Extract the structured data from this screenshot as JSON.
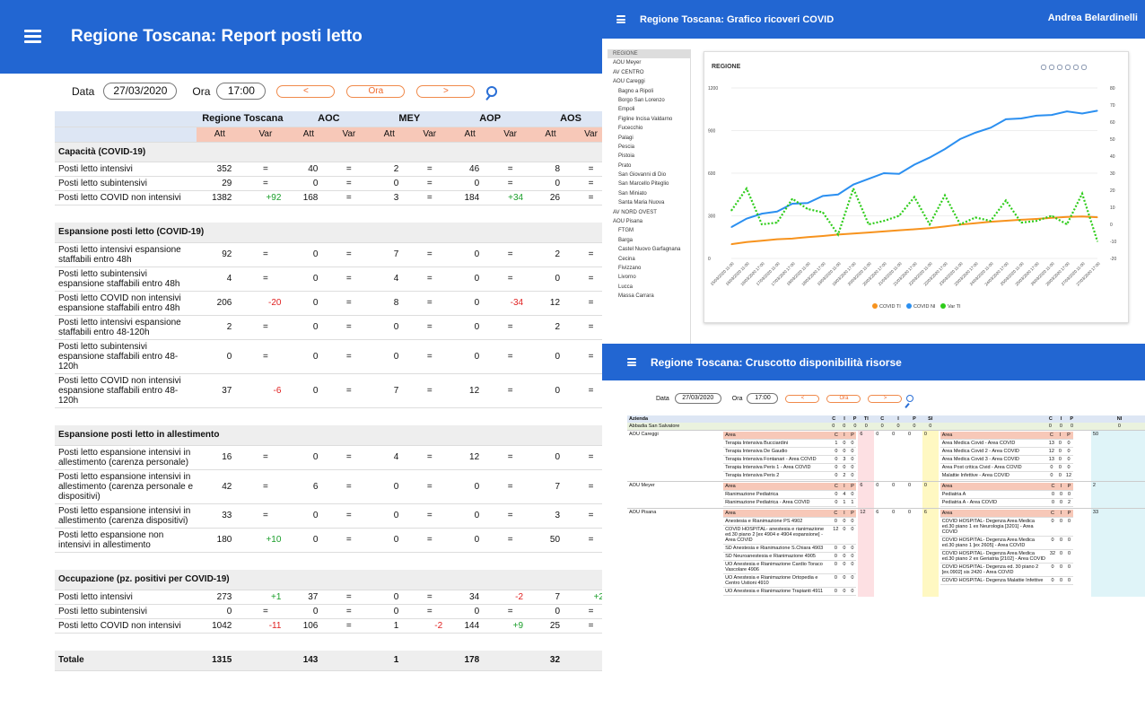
{
  "report": {
    "title": "Regione Toscana: Report posti letto",
    "data_label": "Data",
    "data_value": "27/03/2020",
    "ora_label": "Ora",
    "ora_value": "17:00",
    "btn_prev": "<",
    "btn_now": "Ora",
    "btn_next": ">",
    "columns": [
      "Regione Toscana",
      "AOC",
      "MEY",
      "AOP",
      "AOS"
    ],
    "att": "Att",
    "var": "Var",
    "sections": [
      {
        "title": "Capacità (COVID-19)",
        "rows": [
          {
            "label": "Posti letto intensivi",
            "vals": [
              "352",
              "=",
              "40",
              "=",
              "2",
              "=",
              "46",
              "=",
              "8",
              "="
            ]
          },
          {
            "label": "Posti letto subintensivi",
            "vals": [
              "29",
              "=",
              "0",
              "=",
              "0",
              "=",
              "0",
              "=",
              "0",
              "="
            ]
          },
          {
            "label": "Posti letto COVID non intensivi",
            "vals": [
              "1382",
              "+92",
              "168",
              "=",
              "3",
              "=",
              "184",
              "+34",
              "26",
              "="
            ]
          }
        ]
      },
      {
        "title": "Espansione posti letto (COVID-19)",
        "rows": [
          {
            "label": "Posti letto intensivi espansione staffabili entro 48h",
            "vals": [
              "92",
              "=",
              "0",
              "=",
              "7",
              "=",
              "0",
              "=",
              "2",
              "="
            ]
          },
          {
            "label": "Posti letto subintensivi espansione staffabili entro 48h",
            "vals": [
              "4",
              "=",
              "0",
              "=",
              "4",
              "=",
              "0",
              "=",
              "0",
              "="
            ]
          },
          {
            "label": "Posti letto COVID non intensivi espansione staffabili entro 48h",
            "vals": [
              "206",
              "-20",
              "0",
              "=",
              "8",
              "=",
              "0",
              "-34",
              "12",
              "="
            ]
          },
          {
            "label": "Posti letto intensivi espansione staffabili entro 48-120h",
            "vals": [
              "2",
              "=",
              "0",
              "=",
              "0",
              "=",
              "0",
              "=",
              "2",
              "="
            ]
          },
          {
            "label": "Posti letto subintensivi espansione staffabili entro 48-120h",
            "vals": [
              "0",
              "=",
              "0",
              "=",
              "0",
              "=",
              "0",
              "=",
              "0",
              "="
            ]
          },
          {
            "label": "Posti letto COVID non intensivi espansione staffabili entro 48-120h",
            "vals": [
              "37",
              "-6",
              "0",
              "=",
              "7",
              "=",
              "12",
              "=",
              "0",
              "="
            ]
          }
        ]
      },
      {
        "title": "Espansione posti letto in allestimento",
        "rows": [
          {
            "label": "Posti letto espansione intensivi in allestimento (carenza personale)",
            "vals": [
              "16",
              "=",
              "0",
              "=",
              "4",
              "=",
              "12",
              "=",
              "0",
              "="
            ]
          },
          {
            "label": "Posti letto espansione intensivi in allestimento (carenza personale e dispositivi)",
            "vals": [
              "42",
              "=",
              "6",
              "=",
              "0",
              "=",
              "0",
              "=",
              "7",
              "="
            ]
          },
          {
            "label": "Posti letto espansione intensivi in allestimento (carenza dispositivi)",
            "vals": [
              "33",
              "=",
              "0",
              "=",
              "0",
              "=",
              "0",
              "=",
              "3",
              "="
            ]
          },
          {
            "label": "Posti letto espansione non intensivi in allestimento",
            "vals": [
              "180",
              "+10",
              "0",
              "=",
              "0",
              "=",
              "0",
              "=",
              "50",
              "="
            ]
          }
        ]
      },
      {
        "title": "Occupazione (pz. positivi per COVID-19)",
        "rows": [
          {
            "label": "Posti letto intensivi",
            "vals": [
              "273",
              "+1",
              "37",
              "=",
              "0",
              "=",
              "34",
              "-2",
              "7",
              "+2"
            ]
          },
          {
            "label": "Posti letto subintensivi",
            "vals": [
              "0",
              "=",
              "0",
              "=",
              "0",
              "=",
              "0",
              "=",
              "0",
              "="
            ]
          },
          {
            "label": "Posti letto COVID non intensivi",
            "vals": [
              "1042",
              "-11",
              "106",
              "=",
              "1",
              "-2",
              "144",
              "+9",
              "25",
              "="
            ]
          }
        ]
      }
    ],
    "total_label": "Totale",
    "total_vals": [
      "1315",
      "",
      "143",
      "",
      "1",
      "",
      "178",
      "",
      "32",
      ""
    ]
  },
  "chart_panel": {
    "title": "Regione Toscana: Grafico ricoveri COVID",
    "user": "Andrea Belardinelli",
    "sidebar": [
      "REGIONE",
      "AOU Meyer",
      "AV CENTRO",
      "AOU Careggi",
      "Bagno a Ripoli",
      "Borgo San Lorenzo",
      "Empoli",
      "Figline Incisa Valdarno",
      "Fucecchio",
      "Palagi",
      "Pescia",
      "Pistoia",
      "Prato",
      "San Giovanni di Dio",
      "San Marcello Piteglio",
      "San Miniato",
      "Santa Maria Nuova",
      "AV NORD OVEST",
      "AOU Pisana",
      "FTGM",
      "Barga",
      "Castel Nuovo Garfagnana",
      "Cecina",
      "Fivizzano",
      "Livorno",
      "Lucca",
      "Massa Carrara"
    ]
  },
  "chart_data": {
    "type": "line",
    "title": "REGIONE",
    "x": [
      "15/03/2020 11:00",
      "16/03/2020 11:00",
      "16/03/2020 17:00",
      "17/03/2020 11:00",
      "17/03/2020 17:00",
      "18/03/2020 11:00",
      "18/03/2020 17:00",
      "19/03/2020 11:00",
      "19/03/2020 17:00",
      "20/03/2020 11:00",
      "20/03/2020 17:00",
      "21/03/2020 11:00",
      "21/03/2020 17:00",
      "22/03/2020 11:00",
      "22/03/2020 17:00",
      "23/03/2020 11:00",
      "23/03/2020 17:00",
      "24/03/2020 11:00",
      "24/03/2020 17:00",
      "25/03/2020 11:00",
      "25/03/2020 17:00",
      "26/03/2020 11:00",
      "26/03/2020 17:00",
      "27/03/2020 11:00",
      "27/03/2020 17:00"
    ],
    "series": [
      {
        "name": "COVID TI",
        "axis": "left",
        "color": "#f7931e",
        "values": [
          100,
          115,
          125,
          135,
          140,
          150,
          158,
          168,
          175,
          182,
          190,
          198,
          205,
          213,
          225,
          238,
          248,
          258,
          265,
          272,
          278,
          286,
          292,
          295,
          290
        ]
      },
      {
        "name": "COVID NI",
        "axis": "left",
        "color": "#2b8ff0",
        "values": [
          220,
          280,
          315,
          330,
          385,
          390,
          440,
          450,
          520,
          560,
          600,
          595,
          660,
          710,
          770,
          840,
          885,
          920,
          980,
          985,
          1005,
          1010,
          1035,
          1020,
          1040
        ]
      },
      {
        "name": "Var TI",
        "axis": "right",
        "color": "#2ecc1a",
        "values": [
          8,
          21,
          0,
          1,
          15,
          9,
          7,
          -6,
          21,
          0,
          2,
          5,
          16,
          0,
          17,
          0,
          4,
          2,
          14,
          1,
          2,
          5,
          0,
          18,
          -10
        ]
      }
    ],
    "yleft": [
      0,
      300,
      600,
      900,
      1200
    ],
    "yright": [
      -20,
      -10,
      0,
      10,
      20,
      30,
      40,
      50,
      60,
      70,
      80
    ],
    "ylim_left": [
      0,
      1200
    ],
    "ylim_right": [
      -20,
      80
    ],
    "legend": "bottom-center",
    "grid": true
  },
  "resource_panel": {
    "title": "Regione Toscana: Cruscotto disponibilità risorse",
    "data_label": "Data",
    "data_value": "27/03/2020",
    "ora_label": "Ora",
    "ora_value": "17:00",
    "btn_prev": "<",
    "btn_now": "Ora",
    "btn_next": ">",
    "headers": [
      "Azienda",
      "C",
      "I",
      "P",
      "TI",
      "C",
      "I",
      "P",
      "SI",
      "C",
      "I",
      "P",
      "NI"
    ],
    "abbadia": {
      "name": "Abbadia San Salvatore",
      "vals": [
        "0",
        "0",
        "0",
        "0",
        "0",
        "0",
        "0",
        "0",
        "0",
        "0",
        "0",
        "0"
      ]
    },
    "area_hdr": "Area",
    "cip": [
      "C",
      "I",
      "P"
    ],
    "groups": [
      {
        "name": "AOU Careggi",
        "ti": [
          "Terapia Intensiva Bucciardini|1|0|0",
          "Terapia Intensiva De Gaudio|0|0|0",
          "Terapia Intensiva Fontanari - Area COVID|0|3|0",
          "Terapia Intensiva Peris 1 - Area COVID|0|0|0",
          "Terapia Intensiva Peris 2|0|2|0"
        ],
        "sums": [
          "6",
          "0",
          "0",
          "0",
          "0",
          "50"
        ],
        "ni": [
          "Area Medica Covid - Area COVID|13|0|0",
          "Area Medica Covid 2 - Area COVID|12|0|0",
          "Area Medica Covid 3 - Area COVID|13|0|0",
          "Area Post critica Civid - Area COVID|0|0|0",
          "Malattie Infettive - Area COVID|0|0|12"
        ]
      },
      {
        "name": "AOU Meyer",
        "ti": [
          "Rianimazione Pediatrica|0|4|0",
          "Rianimazione Pediatrica - Area COVID|0|1|1"
        ],
        "sums": [
          "6",
          "0",
          "0",
          "0",
          "0",
          "2"
        ],
        "ni": [
          "Pediatria A|0|0|0",
          "Pediatria A - Area COVID|0|0|2"
        ]
      },
      {
        "name": "AOU Pisana",
        "ti": [
          "Anestesia e Rianimazione PS 4902|0|0|0",
          "COVID HOSPITAL- anestesia e rianimazione ed.30 piano 2 [ex 4904 e 4904 espansione] - Area COVID|12|0|0",
          "SD Anestesia e Rianimazione S.Chiara 4903|0|0|0",
          "SD Neuroanestesia e Rianimazione 4905|0|0|0",
          "UO Anestesia e Rianimazione Cardio Toraco Vascolare 4906|0|0|0",
          "UO Anestesia e Rianimazione Ortopedia e Centro Ustioni 4910|0|0|0",
          "UO Anestesia e Rianimazione Trapianti 4911|0|0|0"
        ],
        "sums": [
          "12",
          "6",
          "0",
          "0",
          "6",
          "33"
        ],
        "ni": [
          "COVID HOSPITAL- Degenza Area Medica ed.30 piano 1 ex Neurologia [3201] - Area COVID|0|0|0",
          "COVID HOSPITAL- Degenza Area Medica ed.30 piano 1 [ex 2605] - Area COVID|0|0|0",
          "COVID HOSPITAL- Degenza Area Medica ed.30 piano 2 ex Geriatria [2102] - Area COVID|32|0|0",
          "COVID HOSPITAL- Degenza ed. 30 piano 2 [ex.0902] sis 2420 - Area COVID|0|0|0",
          "COVID HOSPITAL- Degenza Malattie Infettive|0|0|0"
        ]
      }
    ]
  }
}
